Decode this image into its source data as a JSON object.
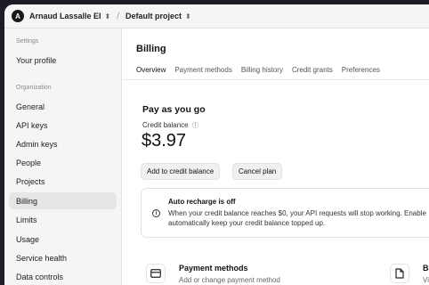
{
  "topbar": {
    "avatar_letter": "A",
    "org_name": "Arnaud Lassalle EI",
    "separator": "/",
    "project_name": "Default project"
  },
  "sidebar": {
    "settings_label": "Settings",
    "your_profile": "Your profile",
    "organization_label": "Organization",
    "items": [
      "General",
      "API keys",
      "Admin keys",
      "People",
      "Projects",
      "Billing",
      "Limits",
      "Usage",
      "Service health",
      "Data controls"
    ],
    "active_item": "Billing"
  },
  "billing": {
    "title": "Billing",
    "tabs": [
      "Overview",
      "Payment methods",
      "Billing history",
      "Credit grants",
      "Preferences"
    ],
    "active_tab": "Overview",
    "payg_title": "Pay as you go",
    "credit_label": "Credit balance",
    "credit_amount": "$3.97",
    "add_credit_button": "Add to credit balance",
    "cancel_plan_button": "Cancel plan",
    "notice": {
      "title": "Auto recharge is off",
      "text": "When your credit balance reaches $0, your API requests will stop working. Enable automatically keep your credit balance topped up."
    },
    "cards": [
      {
        "title": "Payment methods",
        "subtitle": "Add or change payment method"
      },
      {
        "title": "Bi",
        "subtitle": "Vi"
      }
    ]
  }
}
